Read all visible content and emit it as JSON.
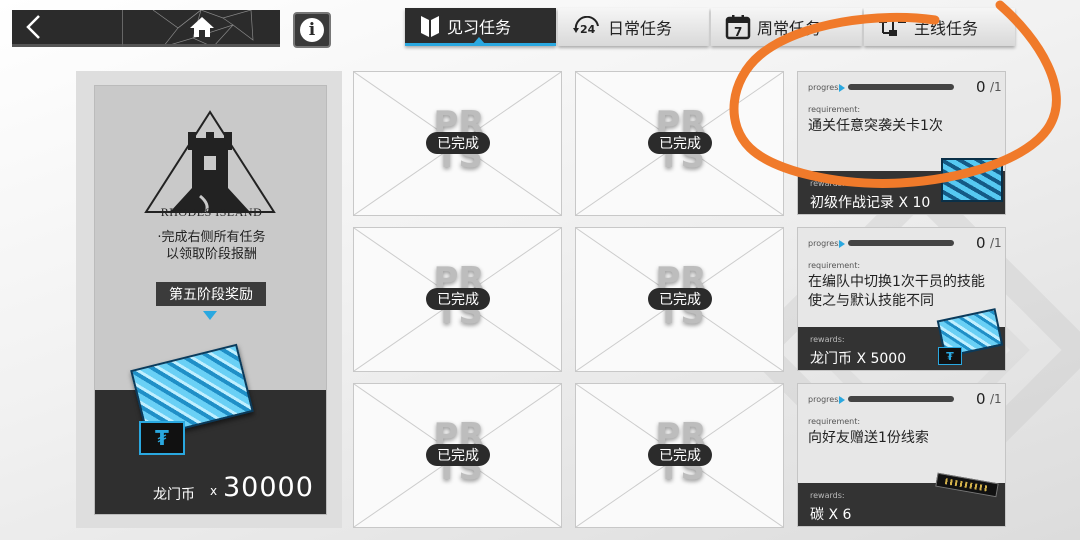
{
  "nav": {
    "back_icon": "chevron-left-icon",
    "home_icon": "home-icon",
    "info_icon": "info-icon",
    "info_glyph": "i"
  },
  "tabs": [
    {
      "label": "见习任务",
      "icon": "bookmark-icon",
      "active": true
    },
    {
      "label": "日常任务",
      "icon": "24-hour-icon",
      "active": false
    },
    {
      "label": "周常任务",
      "icon": "calendar-7-icon",
      "active": false
    },
    {
      "label": "主线任务",
      "icon": "tree-icon",
      "active": false
    }
  ],
  "left_panel": {
    "logo_text": "RHODES ISLAND",
    "desc_line1": "·完成右侧所有任务",
    "desc_line2": "以领取阶段报酬",
    "stage_label": "第五阶段奖励",
    "reward_name": "龙门币",
    "reward_x": "x",
    "reward_qty": "30000"
  },
  "completed": {
    "stamp": "已完成",
    "watermark_line1": "PR",
    "watermark_line2": "TS"
  },
  "tasks": [
    {
      "progress_label": "progress",
      "progress_done": "0",
      "progress_total": "/1",
      "requirement_label": "requirement:",
      "requirement": "通关任意突袭关卡1次",
      "rewards_label": "rewards:",
      "reward": "初级作战记录 X 10"
    },
    {
      "progress_label": "progress",
      "progress_done": "0",
      "progress_total": "/1",
      "requirement_label": "requirement:",
      "requirement": "在编队中切换1次干员的技能使之与默认技能不同",
      "rewards_label": "rewards:",
      "reward": "龙门币 X 5000"
    },
    {
      "progress_label": "progress",
      "progress_done": "0",
      "progress_total": "/1",
      "requirement_label": "requirement:",
      "requirement": "向好友赠送1份线索",
      "rewards_label": "rewards:",
      "reward": "碳 X 6"
    }
  ],
  "colors": {
    "accent": "#2aa8e0",
    "dark": "#2b2b2b",
    "annotation": "#f07a2a"
  }
}
